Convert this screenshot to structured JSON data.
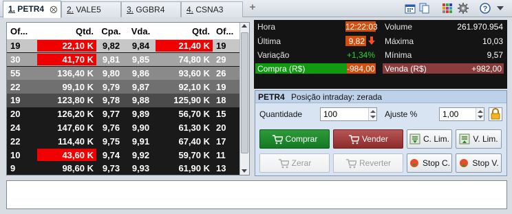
{
  "tabs": [
    {
      "num": "1.",
      "name": "PETR4",
      "active": true
    },
    {
      "num": "2.",
      "name": "VALE5",
      "active": false
    },
    {
      "num": "3.",
      "name": "GGBR4",
      "active": false
    },
    {
      "num": "4.",
      "name": "CSNA3",
      "active": false
    }
  ],
  "book": {
    "headers": [
      "Of...",
      "Qtd.",
      "Cpa.",
      "Vda.",
      "Qtd.",
      "Of..."
    ],
    "rows": [
      {
        "c": [
          "19",
          "22,10 K",
          "9,82",
          "9,84",
          "21,40 K",
          "19"
        ],
        "bg": "#c7c7c7",
        "fg": "#000",
        "hl": [
          1,
          4
        ]
      },
      {
        "c": [
          "30",
          "41,70 K",
          "9,81",
          "9,85",
          "74,80 K",
          "29"
        ],
        "bg": "#a4a4a4",
        "fg": "#fff",
        "hl": [
          1
        ]
      },
      {
        "c": [
          "55",
          "136,40 K",
          "9,80",
          "9,86",
          "93,60 K",
          "26"
        ],
        "bg": "#8a8a8a",
        "fg": "#fff",
        "hl": []
      },
      {
        "c": [
          "22",
          "99,10 K",
          "9,79",
          "9,87",
          "92,10 K",
          "19"
        ],
        "bg": "#707070",
        "fg": "#fff",
        "hl": []
      },
      {
        "c": [
          "19",
          "123,80 K",
          "9,78",
          "9,88",
          "125,90 K",
          "18"
        ],
        "bg": "#4b4b4b",
        "fg": "#fff",
        "hl": []
      },
      {
        "c": [
          "20",
          "126,20 K",
          "9,77",
          "9,89",
          "56,70 K",
          "15"
        ],
        "bg": "#1a1a1a",
        "fg": "#fff",
        "hl": []
      },
      {
        "c": [
          "24",
          "147,60 K",
          "9,76",
          "9,90",
          "61,30 K",
          "20"
        ],
        "bg": "#1a1a1a",
        "fg": "#fff",
        "hl": []
      },
      {
        "c": [
          "22",
          "114,40 K",
          "9,75",
          "9,91",
          "67,40 K",
          "17"
        ],
        "bg": "#1a1a1a",
        "fg": "#fff",
        "hl": []
      },
      {
        "c": [
          "10",
          "43,60 K",
          "9,74",
          "9,92",
          "59,70 K",
          "11"
        ],
        "bg": "#1a1a1a",
        "fg": "#fff",
        "hl": [
          1
        ]
      },
      {
        "c": [
          "9",
          "98,60 K",
          "9,73",
          "9,93",
          "61,90 K",
          "13"
        ],
        "bg": "#1a1a1a",
        "fg": "#fff",
        "hl": []
      }
    ]
  },
  "stats": {
    "hora_label": "Hora",
    "hora": "12:22:03",
    "ultima_label": "Última",
    "ultima": "9,82",
    "variacao_label": "Variação",
    "variacao": "+1,34%",
    "volume_label": "Volume",
    "volume": "261.970.954",
    "maxima_label": "Máxima",
    "maxima": "10,03",
    "minima_label": "Mínima",
    "minima": "9,57",
    "compra_label": "Compra (R$)",
    "compra": "-984,00",
    "venda_label": "Venda (R$)",
    "venda": "+982,00"
  },
  "order": {
    "symbol": "PETR4",
    "position": "Posição intraday: zerada",
    "qty_label": "Quantidade",
    "qty": "100",
    "adj_label": "Ajuste %",
    "adj": "1,00",
    "buy": "Comprar",
    "sell": "Vender",
    "c_lim": "C. Lim.",
    "v_lim": "V. Lim.",
    "zerar": "Zerar",
    "reverter": "Reverter",
    "stop_c": "Stop C.",
    "stop_v": "Stop V."
  },
  "colors": {
    "accent_orange": "#e05a10",
    "green": "#1e9e1e",
    "red": "#f00000",
    "venda": "#8c4040"
  },
  "icons": [
    "calendar-icon",
    "copy-icon",
    "grid-icon",
    "gear-icon",
    "help-icon",
    "dropdown-icon"
  ]
}
